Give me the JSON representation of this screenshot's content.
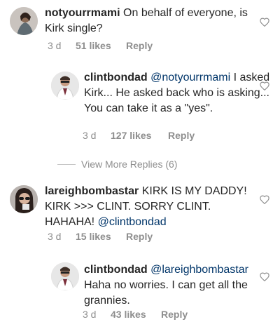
{
  "comments": [
    {
      "username": "notyourrmami",
      "text": " On behalf of everyone, is Kirk single?",
      "mention": "",
      "time": "3 d",
      "likes": "51 likes",
      "reply": "Reply"
    },
    {
      "username": "clintbondad",
      "mention": "@notyourrmami",
      "text": " I asked Kirk... He asked back who is asking... You can take it as a \"yes\".",
      "time": "3 d",
      "likes": "127 likes",
      "reply": "Reply"
    },
    {
      "username": "lareighbombastar",
      "text": " KIRK IS MY DADDY! KIRK >>> CLINT. SORRY CLINT. HAHAHA! ",
      "mention": "@clintbondad",
      "time": "3 d",
      "likes": "15 likes",
      "reply": "Reply"
    },
    {
      "username": "clintbondad",
      "mention": "@lareighbombastar",
      "text": " Haha no worries. I can get all the grannies.",
      "time": "3 d",
      "likes": "43 likes",
      "reply": "Reply"
    }
  ],
  "view_more_replies": "View More Replies (6)",
  "icons": {
    "like": "heart-outline-icon"
  },
  "colors": {
    "mention": "#003569",
    "meta": "#8e8e8e"
  }
}
